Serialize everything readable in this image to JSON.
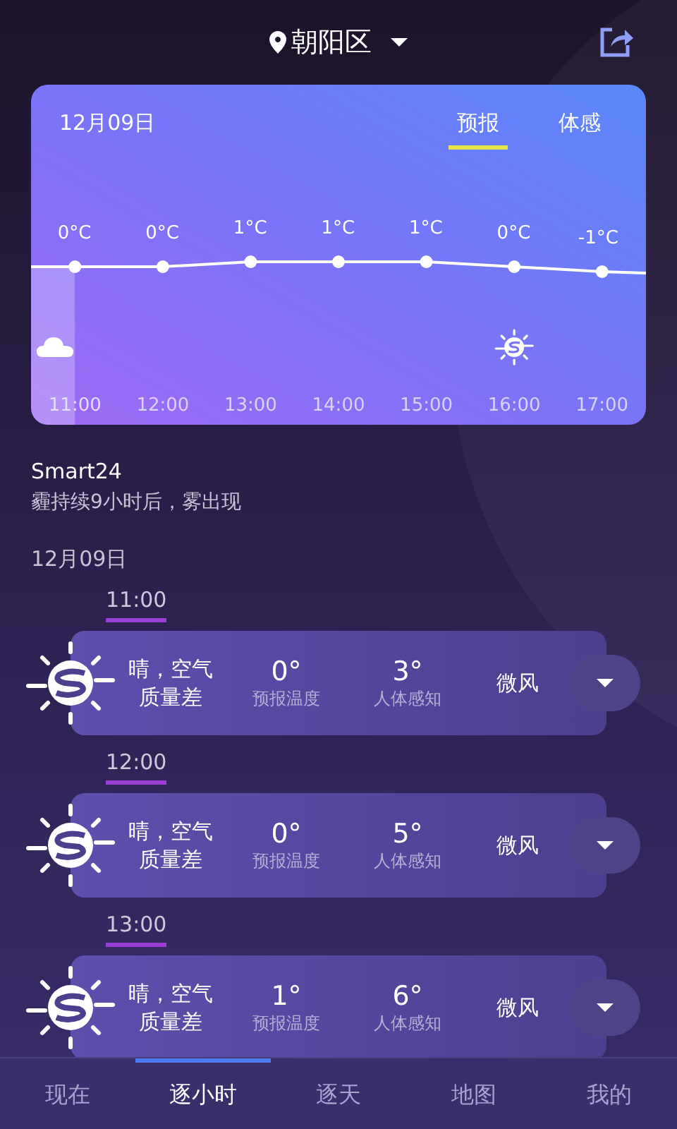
{
  "header": {
    "location": "朝阳区"
  },
  "forecast_card": {
    "date": "12月09日",
    "tabs": [
      {
        "label": "预报",
        "selected": true
      },
      {
        "label": "体感",
        "selected": false
      }
    ],
    "hours": [
      {
        "kind": "cloud",
        "selected": true
      },
      {
        "kind": "none",
        "selected": false
      },
      {
        "kind": "none",
        "selected": false
      },
      {
        "kind": "none",
        "selected": false
      },
      {
        "kind": "none",
        "selected": false
      },
      {
        "kind": "sun",
        "selected": false
      },
      {
        "kind": "none",
        "selected": false
      }
    ],
    "chart_data": {
      "type": "line",
      "categories": [
        "11:00",
        "12:00",
        "13:00",
        "14:00",
        "15:00",
        "16:00",
        "17:00"
      ],
      "series": [
        {
          "color": "#ffffff",
          "marker": "circle",
          "values": [
            0,
            0,
            1,
            1,
            1,
            0,
            -1
          ]
        }
      ],
      "data_labels": true
    },
    "temperature_units": [
      "°C",
      "°C",
      "°C",
      "°C",
      "°C",
      "°C",
      "°C"
    ]
  },
  "summary": {
    "title": "Smart24",
    "text": "霾持续9小时后，雾出现"
  },
  "list_date": "12月09日",
  "rows": [
    {
      "time": "11:00",
      "condition": "晴，空气质量差",
      "temp": "0°",
      "temp_label": "预报温度",
      "feel": "3°",
      "feel_label": "人体感知",
      "wind": "微风"
    },
    {
      "time": "12:00",
      "condition": "晴，空气质量差",
      "temp": "0°",
      "temp_label": "预报温度",
      "feel": "5°",
      "feel_label": "人体感知",
      "wind": "微风"
    },
    {
      "time": "13:00",
      "condition": "晴，空气质量差",
      "temp": "1°",
      "temp_label": "预报温度",
      "feel": "6°",
      "feel_label": "人体感知",
      "wind": "微风"
    }
  ],
  "nav": [
    {
      "label": "现在",
      "selected": false
    },
    {
      "label": "逐小时",
      "selected": true
    },
    {
      "label": "逐天",
      "selected": false
    },
    {
      "label": "地图",
      "selected": false
    },
    {
      "label": "我的",
      "selected": false
    }
  ]
}
